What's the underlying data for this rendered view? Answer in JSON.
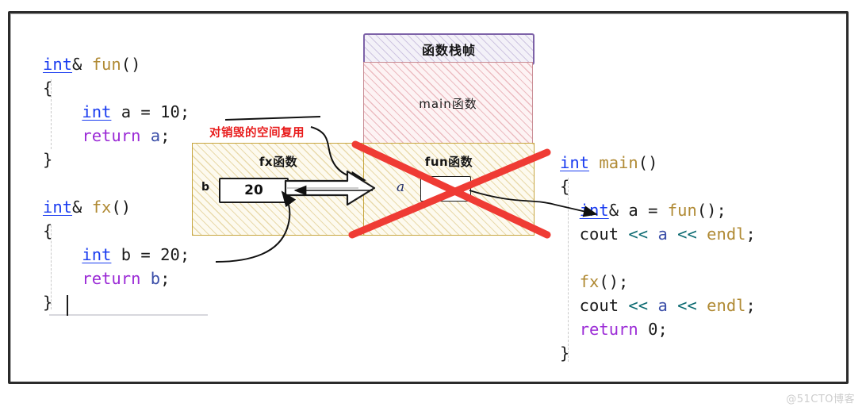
{
  "diagram": {
    "title_box": {
      "label": "函数栈帧"
    },
    "frames": [
      {
        "name": "main-frame",
        "label": "main函数"
      },
      {
        "name": "fx-frame",
        "label": "fx函数",
        "var_name": "b",
        "var_value": "20"
      },
      {
        "name": "fun-frame",
        "label": "fun函数",
        "var_name": "a",
        "var_value": "",
        "struck_out": true
      }
    ],
    "annotation": {
      "text": "对销毁的空间复用",
      "color": "#e81b1b"
    },
    "strike_color": "#ef3b34"
  },
  "code_left": {
    "lines": [
      [
        {
          "t": "int",
          "c": "kw-type"
        },
        {
          "t": "& ",
          "c": "plain"
        },
        {
          "t": "fun",
          "c": "fn"
        },
        {
          "t": "()",
          "c": "plain"
        }
      ],
      [
        {
          "t": "{",
          "c": "plain"
        }
      ],
      [
        {
          "t": "    ",
          "c": "plain"
        },
        {
          "t": "int",
          "c": "kw-type"
        },
        {
          "t": " a = ",
          "c": "plain"
        },
        {
          "t": "10",
          "c": "num"
        },
        {
          "t": ";",
          "c": "plain"
        }
      ],
      [
        {
          "t": "    ",
          "c": "plain"
        },
        {
          "t": "return",
          "c": "kw-ret"
        },
        {
          "t": " ",
          "c": "plain"
        },
        {
          "t": "a",
          "c": "var"
        },
        {
          "t": ";",
          "c": "plain"
        }
      ],
      [
        {
          "t": "}",
          "c": "plain"
        }
      ],
      [
        {
          "t": " ",
          "c": "plain"
        }
      ],
      [
        {
          "t": "int",
          "c": "kw-type"
        },
        {
          "t": "& ",
          "c": "plain"
        },
        {
          "t": "fx",
          "c": "fn"
        },
        {
          "t": "()",
          "c": "plain"
        }
      ],
      [
        {
          "t": "{",
          "c": "plain"
        }
      ],
      [
        {
          "t": "    ",
          "c": "plain"
        },
        {
          "t": "int",
          "c": "kw-type"
        },
        {
          "t": " b = ",
          "c": "plain"
        },
        {
          "t": "20",
          "c": "num"
        },
        {
          "t": ";",
          "c": "plain"
        }
      ],
      [
        {
          "t": "    ",
          "c": "plain"
        },
        {
          "t": "return",
          "c": "kw-ret"
        },
        {
          "t": " ",
          "c": "plain"
        },
        {
          "t": "b",
          "c": "var"
        },
        {
          "t": ";",
          "c": "plain"
        }
      ],
      [
        {
          "t": "}",
          "c": "plain"
        }
      ]
    ]
  },
  "code_right": {
    "lines": [
      [
        {
          "t": "int",
          "c": "kw-type"
        },
        {
          "t": " ",
          "c": "plain"
        },
        {
          "t": "main",
          "c": "fn"
        },
        {
          "t": "()",
          "c": "plain"
        }
      ],
      [
        {
          "t": "{",
          "c": "plain"
        }
      ],
      [
        {
          "t": "  ",
          "c": "plain"
        },
        {
          "t": "int",
          "c": "kw-type"
        },
        {
          "t": "& a = ",
          "c": "plain"
        },
        {
          "t": "fun",
          "c": "fn"
        },
        {
          "t": "();",
          "c": "plain"
        }
      ],
      [
        {
          "t": "  cout ",
          "c": "plain"
        },
        {
          "t": "<<",
          "c": "op"
        },
        {
          "t": " ",
          "c": "plain"
        },
        {
          "t": "a",
          "c": "var"
        },
        {
          "t": " ",
          "c": "plain"
        },
        {
          "t": "<<",
          "c": "op"
        },
        {
          "t": " ",
          "c": "plain"
        },
        {
          "t": "endl",
          "c": "fn"
        },
        {
          "t": ";",
          "c": "plain"
        }
      ],
      [
        {
          "t": " ",
          "c": "plain"
        }
      ],
      [
        {
          "t": "  ",
          "c": "plain"
        },
        {
          "t": "fx",
          "c": "fn"
        },
        {
          "t": "();",
          "c": "plain"
        }
      ],
      [
        {
          "t": "  cout ",
          "c": "plain"
        },
        {
          "t": "<<",
          "c": "op"
        },
        {
          "t": " ",
          "c": "plain"
        },
        {
          "t": "a",
          "c": "var"
        },
        {
          "t": " ",
          "c": "plain"
        },
        {
          "t": "<<",
          "c": "op"
        },
        {
          "t": " ",
          "c": "plain"
        },
        {
          "t": "endl",
          "c": "fn"
        },
        {
          "t": ";",
          "c": "plain"
        }
      ],
      [
        {
          "t": "  ",
          "c": "plain"
        },
        {
          "t": "return",
          "c": "kw-ret"
        },
        {
          "t": " ",
          "c": "plain"
        },
        {
          "t": "0",
          "c": "num"
        },
        {
          "t": ";",
          "c": "plain"
        }
      ],
      [
        {
          "t": "}",
          "c": "plain"
        }
      ]
    ]
  },
  "watermark": {
    "text": "@51CTO博客"
  }
}
